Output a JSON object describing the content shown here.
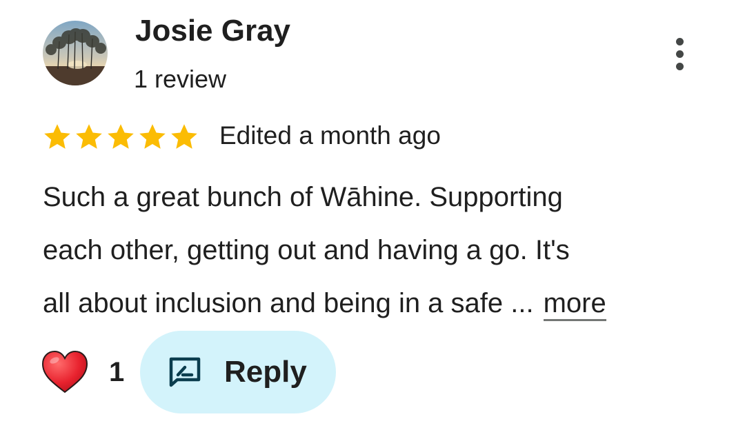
{
  "reviewer": {
    "name": "Josie Gray",
    "review_count": "1 review",
    "avatar_icon": "profile-photo-trees-sunset"
  },
  "menu_icon": "more-vert-icon",
  "rating": {
    "stars": 5,
    "max": 5,
    "star_color": "#fbbc04"
  },
  "edited_label": "Edited a month ago",
  "review_text": {
    "lines": [
      "Such a great bunch of Wāhine. Supporting",
      "each other, getting out and having a go. It's",
      "all about inclusion and being in a safe ..."
    ],
    "more_label": "more"
  },
  "actions": {
    "like_icon": "heart-icon",
    "like_count": "1",
    "reply_icon": "reply-message-icon",
    "reply_label": "Reply",
    "reply_bg": "#d3f3fb"
  }
}
